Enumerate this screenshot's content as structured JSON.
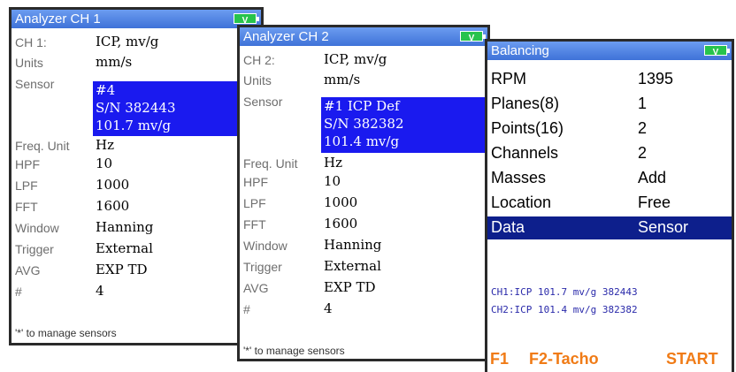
{
  "analyzer1": {
    "title": "Analyzer CH 1",
    "battery": "V",
    "rows": [
      {
        "label": "CH 1:",
        "value": "ICP, mv/g"
      },
      {
        "label": "Units",
        "value": "mm/s"
      },
      {
        "label": "Sensor",
        "value": ""
      },
      {
        "label": "Freq. Unit",
        "value": "Hz"
      },
      {
        "label": "HPF",
        "value": "10"
      },
      {
        "label": "LPF",
        "value": "1000"
      },
      {
        "label": "FFT",
        "value": "1600"
      },
      {
        "label": "Window",
        "value": "Hanning"
      },
      {
        "label": "Trigger",
        "value": "External"
      },
      {
        "label": "AVG",
        "value": "EXP TD"
      },
      {
        "label": "#",
        "value": "4"
      }
    ],
    "sensor_lines": [
      "#4",
      "S/N 382443",
      "101.7 mv/g"
    ],
    "footnote": "'*' to manage sensors"
  },
  "analyzer2": {
    "title": "Analyzer CH 2",
    "battery": "V",
    "rows": [
      {
        "label": "CH 2:",
        "value": "ICP, mv/g"
      },
      {
        "label": "Units",
        "value": "mm/s"
      },
      {
        "label": "Sensor",
        "value": ""
      },
      {
        "label": "Freq. Unit",
        "value": "Hz"
      },
      {
        "label": "HPF",
        "value": "10"
      },
      {
        "label": "LPF",
        "value": "1000"
      },
      {
        "label": "FFT",
        "value": "1600"
      },
      {
        "label": "Window",
        "value": "Hanning"
      },
      {
        "label": "Trigger",
        "value": "External"
      },
      {
        "label": "AVG",
        "value": "EXP TD"
      },
      {
        "label": "#",
        "value": "4"
      }
    ],
    "sensor_lines": [
      "#1 ICP Def",
      "S/N 382382",
      "101.4 mv/g"
    ],
    "footnote": "'*' to manage sensors"
  },
  "balancing": {
    "title": "Balancing",
    "battery": "V",
    "rows": [
      {
        "label": "RPM",
        "value": "1395"
      },
      {
        "label": "Planes(8)",
        "value": "1"
      },
      {
        "label": "Points(16)",
        "value": "2"
      },
      {
        "label": "Channels",
        "value": "2"
      },
      {
        "label": "Masses",
        "value": "Add"
      },
      {
        "label": "Location",
        "value": "Free"
      },
      {
        "label": "Data",
        "value": "Sensor"
      }
    ],
    "info_lines": [
      "CH1:ICP 101.7 mv/g 382443",
      "CH2:ICP 101.4 mv/g 382382"
    ],
    "fkeys": {
      "f1": "F1",
      "f2": "F2-Tacho",
      "start": "START"
    }
  },
  "colors": {
    "selection": "#1a1aef",
    "active_row": "#0d1f8c",
    "fkey": "#f07b16",
    "title": "#3f72d8"
  }
}
